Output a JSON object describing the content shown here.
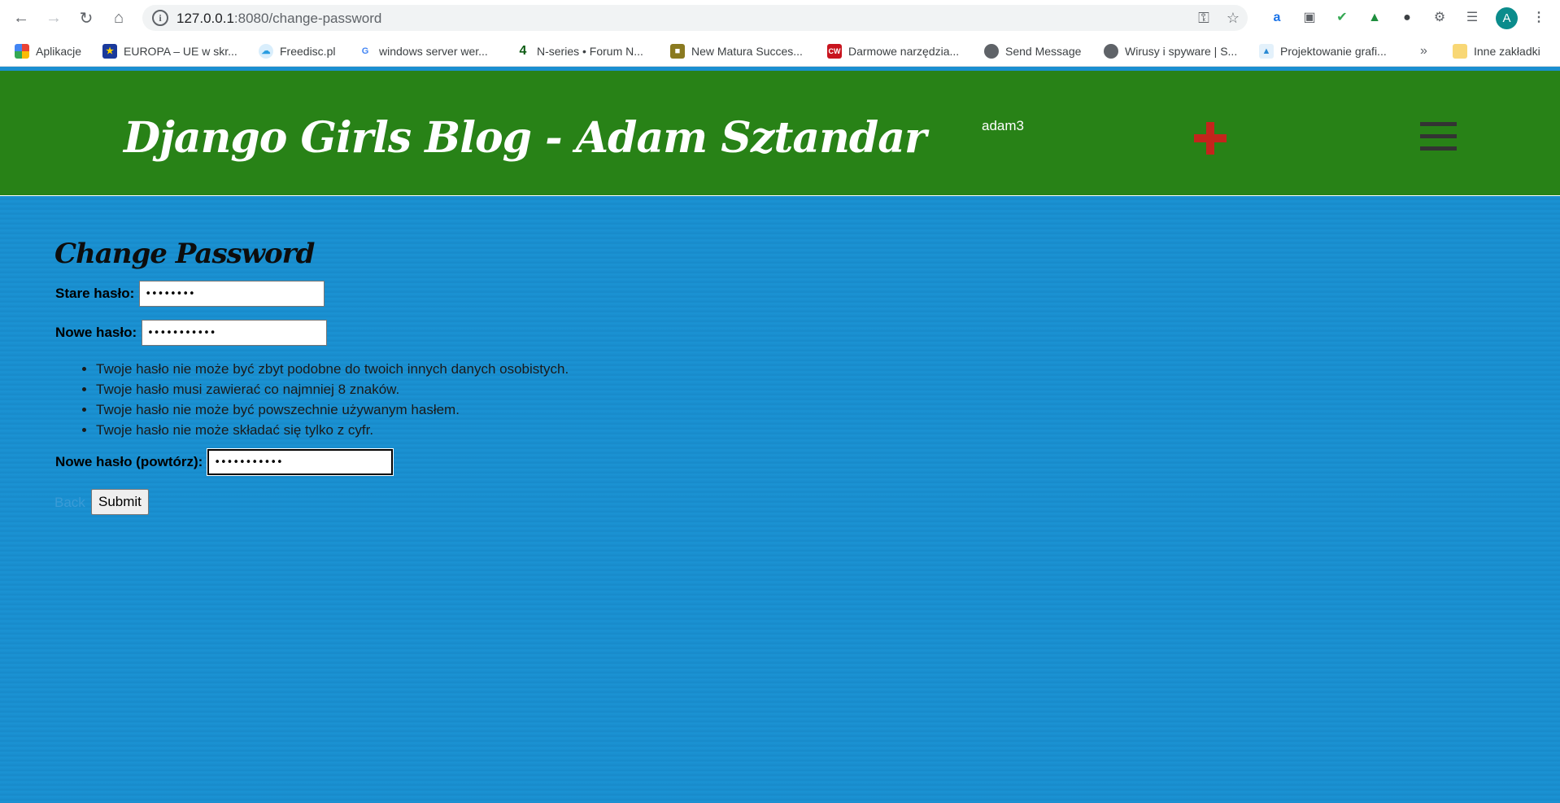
{
  "browser": {
    "url_host": "127.0.0.1",
    "url_rest": ":8080/change-password",
    "bookmarks": [
      {
        "label": "Aplikacje",
        "icon": "apps-grid-icon"
      },
      {
        "label": "EUROPA – UE w skr...",
        "icon": "eu-flag-icon"
      },
      {
        "label": "Freedisc.pl",
        "icon": "cloud-icon"
      },
      {
        "label": "windows server wer...",
        "icon": "google-icon"
      },
      {
        "label": "N-series • Forum N...",
        "icon": "four-logo-icon"
      },
      {
        "label": "New Matura Succes...",
        "icon": "matura-icon"
      },
      {
        "label": "Darmowe narzędzia...",
        "icon": "cw-icon"
      },
      {
        "label": "Send Message",
        "icon": "globe-icon"
      },
      {
        "label": "Wirusy i spyware | S...",
        "icon": "globe-icon"
      },
      {
        "label": "Projektowanie grafi...",
        "icon": "design-icon"
      }
    ],
    "overflow_label": "»",
    "other_bookmarks": "Inne zakładki",
    "avatar_letter": "A"
  },
  "header": {
    "title": "Django Girls Blog - Adam Sztandar",
    "username": "adam3",
    "accent_color": "#288217",
    "plus_color": "#c4241c"
  },
  "form": {
    "title": "Change Password",
    "old_label": "Stare hasło:",
    "old_value": "••••••••",
    "new_label": "Nowe hasło:",
    "new_value": "•••••••••••",
    "rules": [
      "Twoje hasło nie może być zbyt podobne do twoich innych danych osobistych.",
      "Twoje hasło musi zawierać co najmniej 8 znaków.",
      "Twoje hasło nie może być powszechnie używanym hasłem.",
      "Twoje hasło nie może składać się tylko z cyfr."
    ],
    "confirm_label": "Nowe hasło (powtórz):",
    "confirm_value": "•••••••••••",
    "back_label": "Back",
    "submit_label": "Submit"
  }
}
